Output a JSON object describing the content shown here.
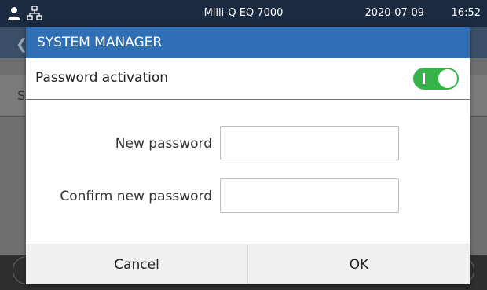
{
  "status_bar": {
    "device_name": "Milli-Q EQ 7000",
    "date": "2020-07-09",
    "time": "16:52",
    "icons": [
      "user-icon",
      "network-icon"
    ]
  },
  "background": {
    "row_label_fragment": "S"
  },
  "dialog": {
    "title": "SYSTEM MANAGER",
    "toggle_label": "Password activation",
    "toggle_on": true,
    "fields": [
      {
        "label": "New password",
        "value": ""
      },
      {
        "label": "Confirm new password",
        "value": ""
      }
    ],
    "buttons": {
      "cancel": "Cancel",
      "ok": "OK"
    }
  },
  "colors": {
    "title_bar": "#2f6fb6",
    "toggle_on": "#35b34a",
    "status_bar": "#1a2a40"
  }
}
